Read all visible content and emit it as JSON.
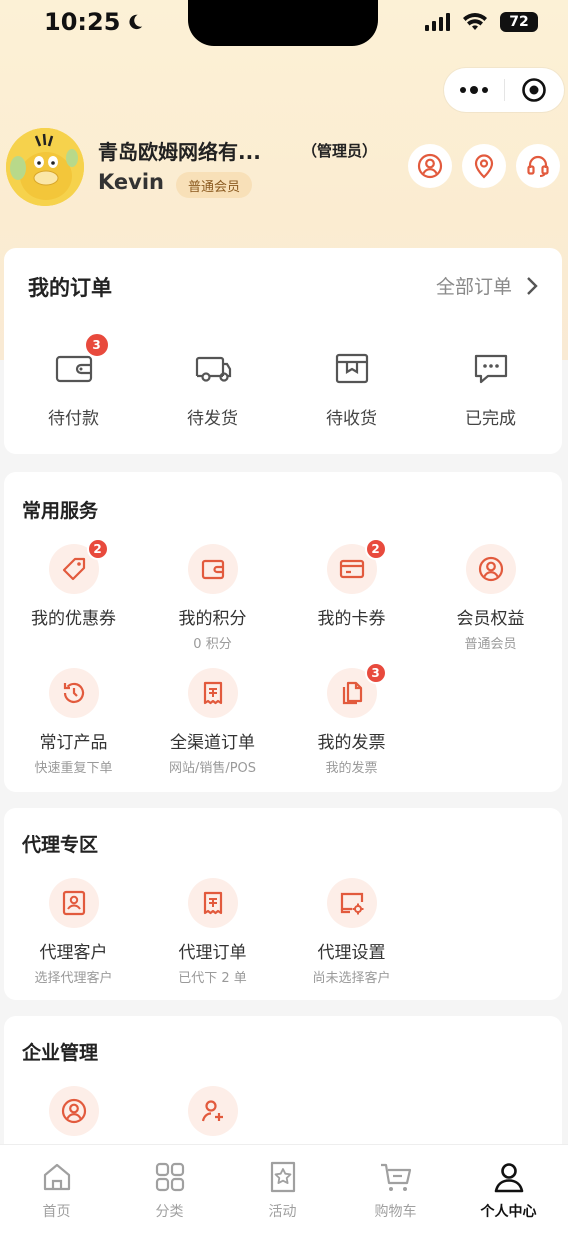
{
  "status_bar": {
    "time": "10:25",
    "battery": "72"
  },
  "profile": {
    "company": "青岛欧姆网络有...",
    "role": "（管理员）",
    "username": "Kevin",
    "member_level": "普通会员"
  },
  "orders": {
    "title": "我的订单",
    "all_label": "全部订单",
    "items": [
      {
        "label": "待付款",
        "badge": "3",
        "icon": "wallet-icon"
      },
      {
        "label": "待发货",
        "badge": "",
        "icon": "truck-icon"
      },
      {
        "label": "待收货",
        "badge": "",
        "icon": "box-icon"
      },
      {
        "label": "已完成",
        "badge": "",
        "icon": "message-icon"
      }
    ]
  },
  "services": {
    "title": "常用服务",
    "items": [
      {
        "label": "我的优惠券",
        "sub": "",
        "badge": "2",
        "icon": "coupon-tag-icon"
      },
      {
        "label": "我的积分",
        "sub": "0 积分",
        "badge": "",
        "icon": "wallet-icon"
      },
      {
        "label": "我的卡券",
        "sub": "",
        "badge": "2",
        "icon": "card-icon"
      },
      {
        "label": "会员权益",
        "sub": "普通会员",
        "badge": "",
        "icon": "member-icon"
      },
      {
        "label": "常订产品",
        "sub": "快速重复下单",
        "badge": "",
        "icon": "history-icon"
      },
      {
        "label": "全渠道订单",
        "sub": "网站/销售/POS",
        "badge": "",
        "icon": "receipt-icon"
      },
      {
        "label": "我的发票",
        "sub": "我的发票",
        "badge": "3",
        "icon": "invoice-icon"
      }
    ]
  },
  "agent": {
    "title": "代理专区",
    "items": [
      {
        "label": "代理客户",
        "sub": "选择代理客户",
        "icon": "agent-customer-icon"
      },
      {
        "label": "代理订单",
        "sub": "已代下 2 单",
        "icon": "receipt-icon"
      },
      {
        "label": "代理设置",
        "sub": "尚未选择客户",
        "icon": "settings-screen-icon"
      }
    ]
  },
  "enterprise": {
    "title": "企业管理",
    "items": [
      {
        "icon": "member-icon"
      },
      {
        "icon": "add-user-icon"
      }
    ]
  },
  "tabbar": {
    "items": [
      {
        "label": "首页",
        "icon": "home-icon",
        "active": false
      },
      {
        "label": "分类",
        "icon": "grid-icon",
        "active": false
      },
      {
        "label": "活动",
        "icon": "star-badge-icon",
        "active": false
      },
      {
        "label": "购物车",
        "icon": "cart-icon",
        "active": false
      },
      {
        "label": "个人中心",
        "icon": "user-icon",
        "active": true
      }
    ]
  },
  "colors": {
    "accent": "#e25a3d",
    "icon_bg": "#fdeee8",
    "badge": "#e84a3d"
  }
}
